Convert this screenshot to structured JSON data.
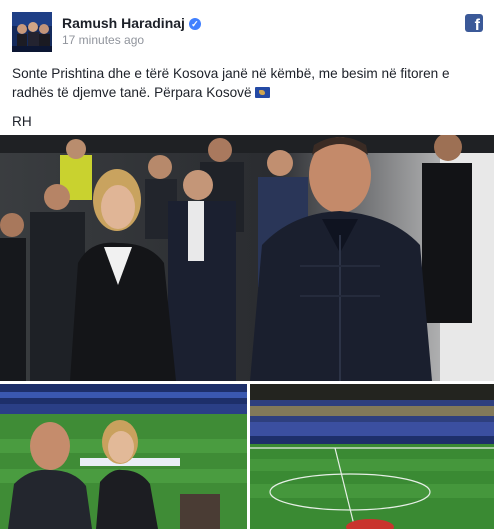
{
  "post": {
    "author": "Ramush Haradinaj",
    "timestamp": "17 minutes ago",
    "text_line": "Sonte Prishtina dhe e tërë Kosova janë në këmbë, me besim në fitoren e radhës të djemve tanë. Përpara Kosovë",
    "signature": "RH"
  },
  "icons": {
    "verified": "verified-badge-icon",
    "platform": "facebook-logo-icon",
    "flag": "kosovo-flag-emoji"
  },
  "colors": {
    "author": "#1d2129",
    "timestamp": "#90949c",
    "verified": "#4080ff",
    "facebook": "#3b5998"
  }
}
